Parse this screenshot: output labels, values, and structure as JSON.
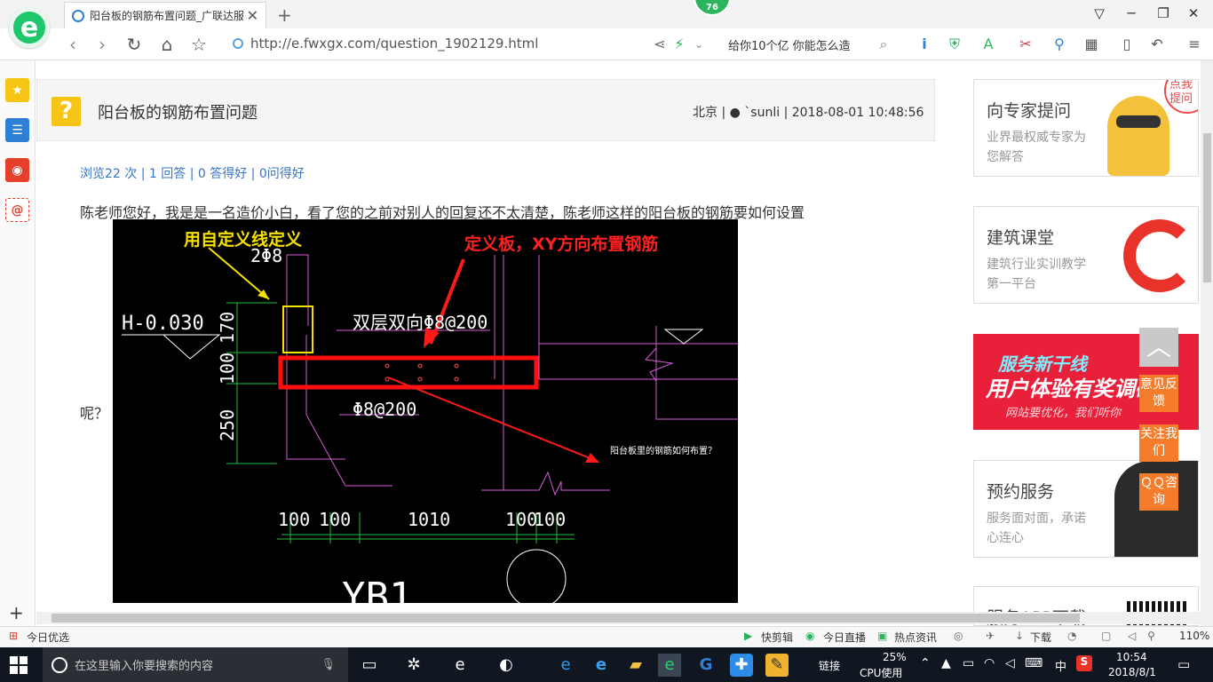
{
  "browser": {
    "tab_title": "阳台板的钢筋布置问题_广联达服",
    "badge": "76",
    "url": "http://e.fwxgx.com/question_1902129.html",
    "search_text": "给你10个亿 你能怎么造",
    "zoom": "110%"
  },
  "question": {
    "title": "阳台板的钢筋布置问题",
    "location": "北京",
    "user": "`sunli",
    "date": "2018-08-01 10:48:56",
    "stats": "浏览22 次 | 1 回答 | 0 答得好 | 0问得好",
    "body_line1": "陈老师您好，我是是一名造价小白，看了您的之前对别人的回复还不太清楚，陈老师这样的阳台板的钢筋要如何设置",
    "body_line2": "呢？"
  },
  "cad": {
    "note_yellow": "用自定义线定义",
    "note_red": "定义板，XY方向布置钢筋",
    "rebar_top": "2Φ8",
    "elevation": "H-0.030",
    "rebar_two_way": "双层双向Φ8@200",
    "rebar_bottom": "Φ8@200",
    "question_note": "阳台板里的钢筋如何布置？",
    "dim_170": "170",
    "dim_100": "100",
    "dim_250": "250",
    "dims_bottom": [
      "100",
      "100",
      "1010",
      "100",
      "100"
    ],
    "label_bottom": "YB1"
  },
  "right": {
    "card1_title": "向专家提问",
    "card1_sub": "业界最权威专家为您解答",
    "card1_corner": "点我提问",
    "card2_title": "建筑课堂",
    "card2_sub": "建筑行业实训教学第一平台",
    "ad_line1": "服务新干线",
    "ad_line2": "用户体验有奖调研",
    "ad_line3": "网站要优化，我们听你",
    "card3_title": "预约服务",
    "card3_sub": "服务面对面，承诺心连心",
    "card4_title": "服务APP下载",
    "float_feedback": "意见反馈",
    "float_follow": "关注我们",
    "float_qq": "ＱＱ咨询"
  },
  "statusbar": {
    "left": "今日优选",
    "kuaijianji": "快剪辑",
    "live": "今日直播",
    "news": "热点资讯",
    "download": "下载",
    "zoom": "110%"
  },
  "taskbar": {
    "search_placeholder": "在这里输入你要搜索的内容",
    "links": "链接",
    "cpu_pct": "25%",
    "cpu_label": "CPU使用",
    "ime": "中",
    "time": "10:54",
    "date": "2018/8/1"
  }
}
